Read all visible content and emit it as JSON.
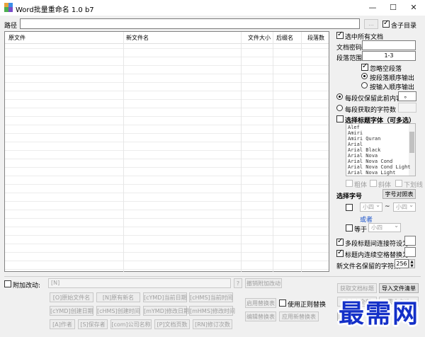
{
  "window": {
    "title": "Word批量重命名 1.0 b7",
    "controls": {
      "minimize": "—",
      "maximize": "☐",
      "close": "✕"
    }
  },
  "path_row": {
    "label": "路径",
    "value": "",
    "browse_label": "...",
    "subdir_label": "含子目录",
    "subdir_checked": true
  },
  "table": {
    "columns": [
      "原文件",
      "新文件名",
      "文件大小",
      "后缀名",
      "段落数"
    ],
    "rows": []
  },
  "right_panel": {
    "select_all_label": "选中所有文档",
    "select_all_checked": true,
    "password_label": "文档密码",
    "password_value": "",
    "range_label": "段落范围",
    "range_value": "1-3",
    "ignore_empty_label": "忽略空段落",
    "ignore_empty_checked": true,
    "order_para_label": "按段落顺序输出",
    "order_input_label": "按输入顺序输出",
    "keep_before_label": "每段仅保留此前内容",
    "keep_before_value": "。",
    "char_count_label": "每段获取的字符数",
    "char_count_value": "",
    "title_font_label": "选择标题字体（可多选）",
    "fonts": [
      "Alef",
      "Amiri",
      "Amiri Quran",
      "Arial",
      "Arial Black",
      "Arial Nova",
      "Arial Nova Cond",
      "Arial Nova Cond Light",
      "Arial Nova Light"
    ],
    "bold_label": "粗体",
    "italic_label": "斜体",
    "underline_label": "下划线",
    "font_size_label": "选择字号",
    "size_table_button": "字号对照表",
    "size_from": "小四",
    "size_tilde": "~",
    "size_to": "小四",
    "or_label": "或者",
    "equal_label": "等于",
    "size_equal": "小四",
    "multi_title_label": "多段标题间连接符设为",
    "multi_title_checked": true,
    "replace_space_label": "标题内连续空格替换为",
    "replace_space_checked": true,
    "keep_chars_label": "新文件名保留的字符数",
    "keep_chars_value": "256"
  },
  "bottom": {
    "attach_label": "附加改动:",
    "attach_value": "[N]",
    "help_button": "?",
    "undo_button": "撤销附加改动",
    "tokens_row1": [
      "[O]原始文件名",
      "[N]原有新名",
      "[cYMD]当前日期",
      "[cHMS]当前时间"
    ],
    "tokens_row2": [
      "[cYMD]创建日期",
      "[cHMS]创建时间",
      "[mYMD]修改日期",
      "[mHMS]修改时间"
    ],
    "tokens_row3": [
      "[A]作者",
      "[S]保存者",
      "[com]公司名称",
      "[P]文档页数",
      "[RN]修订次数"
    ],
    "apply_replace": "启用替换表",
    "use_regex_label": "使用正则替换",
    "edit_replace": "编辑替换表",
    "apply_new_replace": "应用新替换表",
    "get_titles": "获取文档标题",
    "import_list": "导入文件清单",
    "rename_all": "重命名全部",
    "rename_selected": "重命名选",
    "backup_short": "重"
  },
  "watermark": {
    "text": "最需网"
  }
}
